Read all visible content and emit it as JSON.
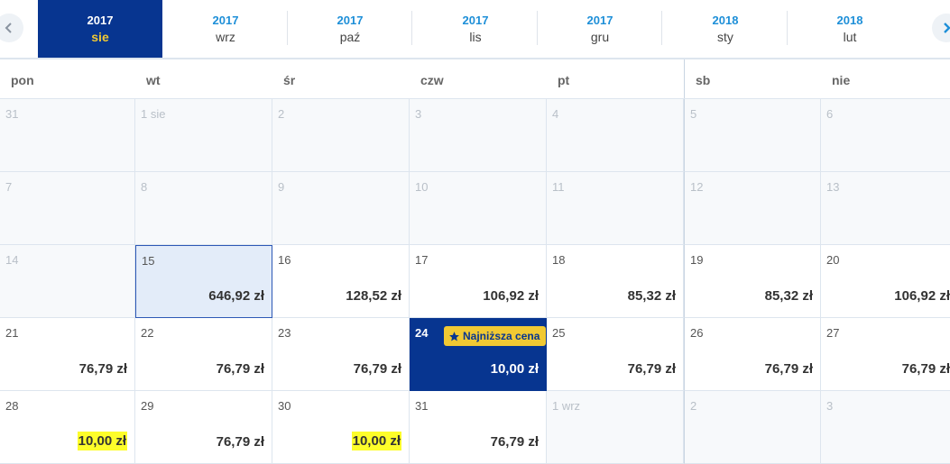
{
  "months": [
    {
      "year": "2017",
      "month": "sie",
      "active": true
    },
    {
      "year": "2017",
      "month": "wrz"
    },
    {
      "year": "2017",
      "month": "paź"
    },
    {
      "year": "2017",
      "month": "lis"
    },
    {
      "year": "2017",
      "month": "gru"
    },
    {
      "year": "2018",
      "month": "sty"
    },
    {
      "year": "2018",
      "month": "lut"
    }
  ],
  "weekdays": [
    "pon",
    "wt",
    "śr",
    "czw",
    "pt",
    "sb",
    "nie"
  ],
  "weeks": [
    [
      {
        "day": "31",
        "empty": true
      },
      {
        "day": "1 sie",
        "empty": true
      },
      {
        "day": "2",
        "empty": true
      },
      {
        "day": "3",
        "empty": true
      },
      {
        "day": "4",
        "empty": true
      },
      {
        "day": "5",
        "empty": true
      },
      {
        "day": "6",
        "empty": true
      }
    ],
    [
      {
        "day": "7",
        "empty": true
      },
      {
        "day": "8",
        "empty": true
      },
      {
        "day": "9",
        "empty": true
      },
      {
        "day": "10",
        "empty": true
      },
      {
        "day": "11",
        "empty": true
      },
      {
        "day": "12",
        "empty": true
      },
      {
        "day": "13",
        "empty": true
      }
    ],
    [
      {
        "day": "14",
        "empty": true
      },
      {
        "day": "15",
        "price": "646,92 zł",
        "selected": true
      },
      {
        "day": "16",
        "price": "128,52 zł"
      },
      {
        "day": "17",
        "price": "106,92 zł"
      },
      {
        "day": "18",
        "price": "85,32 zł"
      },
      {
        "day": "19",
        "price": "85,32 zł"
      },
      {
        "day": "20",
        "price": "106,92 zł"
      }
    ],
    [
      {
        "day": "21",
        "price": "76,79 zł"
      },
      {
        "day": "22",
        "price": "76,79 zł"
      },
      {
        "day": "23",
        "price": "76,79 zł"
      },
      {
        "day": "24",
        "price": "10,00 zł",
        "lowest": true,
        "badge": "Najniższa cena"
      },
      {
        "day": "25",
        "price": "76,79 zł"
      },
      {
        "day": "26",
        "price": "76,79 zł"
      },
      {
        "day": "27",
        "price": "76,79 zł"
      }
    ],
    [
      {
        "day": "28",
        "price": "10,00 zł",
        "highlight": true
      },
      {
        "day": "29",
        "price": "76,79 zł"
      },
      {
        "day": "30",
        "price": "10,00 zł",
        "highlight": true
      },
      {
        "day": "31",
        "price": "76,79 zł"
      },
      {
        "day": "1 wrz",
        "empty": true
      },
      {
        "day": "2",
        "empty": true
      },
      {
        "day": "3",
        "empty": true
      }
    ]
  ],
  "colors": {
    "brand_blue": "#073590",
    "accent_yellow": "#f1c933",
    "year_blue": "#1e8fd8",
    "marker_yellow": "#fdfd2a"
  },
  "icons": {
    "prev": "chevron-left-icon",
    "next": "chevron-right-icon",
    "badge": "star-icon"
  }
}
